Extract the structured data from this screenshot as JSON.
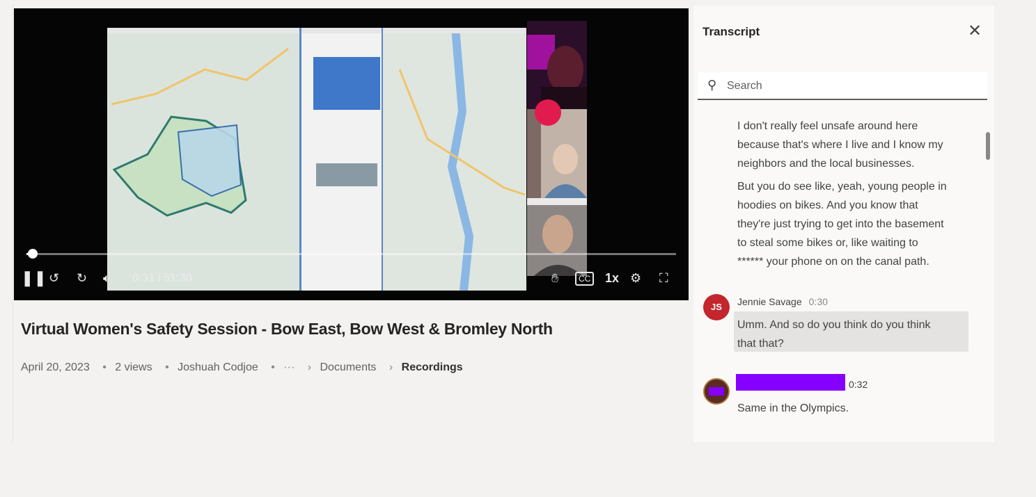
{
  "player": {
    "time": "0:31 / 51:30",
    "progress_fraction": 0.01,
    "speed": "1x",
    "controls": {
      "pause": "pause-icon",
      "rewind": "rewind-10-icon",
      "forward": "forward-10-icon",
      "volume": "volume-icon",
      "raise_hand": "raise-hand-icon",
      "captions": "captions-icon",
      "settings": "gear-icon",
      "fullscreen": "fullscreen-icon"
    }
  },
  "video": {
    "title": "Virtual Women's Safety Session - Bow East, Bow West & Bromley North",
    "date": "April 20, 2023",
    "views": "2 views",
    "owner": "Joshuah Codjoe",
    "breadcrumb": [
      "Documents",
      "Recordings"
    ],
    "more": "···"
  },
  "transcript": {
    "title": "Transcript",
    "search_placeholder": "Search",
    "entries": [
      {
        "lines": [
          "I don't really feel unsafe around here",
          "because that's where I live and I know my",
          "neighbors and the local businesses."
        ]
      },
      {
        "lines": [
          "But you do see like, yeah, young people in",
          "hoodies on bikes. And you know that",
          "they're just trying to get into the basement",
          "to steal some bikes or, like waiting to",
          "****** your phone on on the canal path."
        ]
      },
      {
        "speaker": "Jennie Savage",
        "initials": "JS",
        "time": "0:30",
        "lines": [
          "Umm. And so do you think do you think",
          "that that?"
        ],
        "avatar_color": "#c4262e",
        "highlighted": true
      },
      {
        "speaker": "",
        "initials": "",
        "time": "0:32",
        "lines": [
          "Same in the Olympics."
        ],
        "avatar_color": "#5a2a24",
        "redacted": true
      }
    ]
  },
  "colors": {
    "accent": "#e21b4f",
    "redaction": "#8600ff",
    "panel_bg": "#faf9f8",
    "page_bg": "#f3f2f1"
  }
}
